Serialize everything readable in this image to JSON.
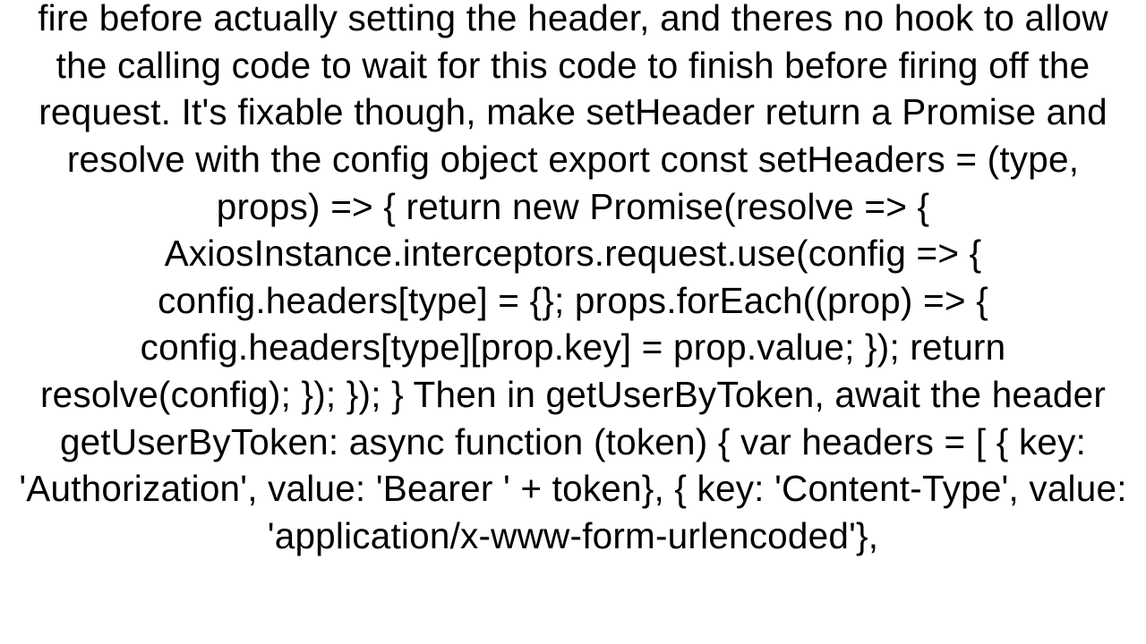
{
  "content": {
    "body": "fire before actually setting the header, and theres no hook to allow the calling code to wait for this code to finish before firing off the request. It's fixable though, make setHeader return a Promise and resolve with the config object export const setHeaders = (type, props) => {   return new Promise(resolve => {     AxiosInstance.interceptors.request.use(config => {       config.headers[type] = {};       props.forEach((prop) => {         config.headers[type][prop.key] = prop.value;       });       return resolve(config);     });   }); }  Then in getUserByToken, await the header getUserByToken: async function (token) {   var headers = [     { key: 'Authorization', value: 'Bearer ' + token},     { key: 'Content-Type', value: 'application/x-www-form-urlencoded'},"
  }
}
